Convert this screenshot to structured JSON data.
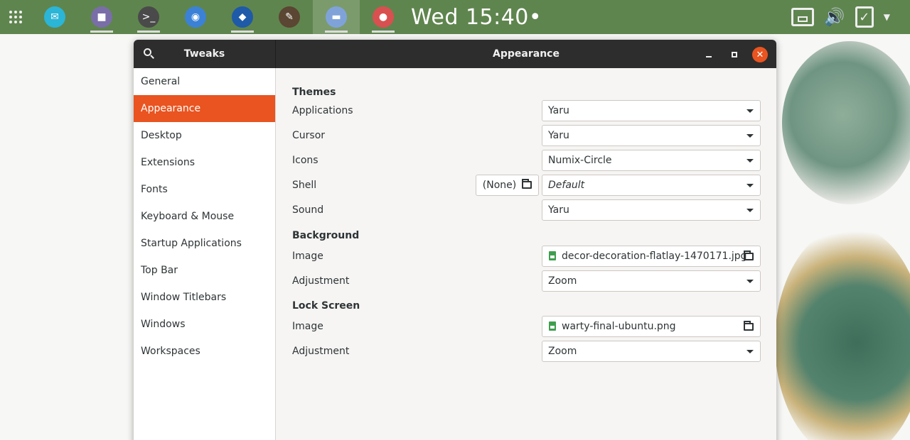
{
  "topbar": {
    "clock": "Wed 15:40",
    "clock_dot": "•",
    "apps": [
      {
        "name": "email-app",
        "icon": "envelope-icon",
        "color": "#2bb5d6",
        "running": false,
        "active": false,
        "glyph": "✉"
      },
      {
        "name": "files-app",
        "icon": "folder-icon",
        "color": "#7a6ea8",
        "running": true,
        "active": false,
        "glyph": "■"
      },
      {
        "name": "terminal-app",
        "icon": "terminal-icon",
        "color": "#4a4a4a",
        "running": true,
        "active": false,
        "glyph": ">_"
      },
      {
        "name": "chromium-app",
        "icon": "chromium-icon",
        "color": "#3b82d6",
        "running": false,
        "active": false,
        "glyph": "◉"
      },
      {
        "name": "vscode-app",
        "icon": "vscode-icon",
        "color": "#1e5aa8",
        "running": true,
        "active": false,
        "glyph": "◆"
      },
      {
        "name": "gimp-app",
        "icon": "gimp-icon",
        "color": "#5a4632",
        "running": false,
        "active": false,
        "glyph": "✎"
      },
      {
        "name": "tweaks-app",
        "icon": "tweaks-icon",
        "color": "#7fa3d9",
        "running": true,
        "active": true,
        "glyph": "▬"
      },
      {
        "name": "settings-app",
        "icon": "toggle-icon",
        "color": "#d95050",
        "running": true,
        "active": false,
        "glyph": "●"
      }
    ]
  },
  "window": {
    "sidebar_title": "Tweaks",
    "title": "Appearance",
    "close_glyph": "✕"
  },
  "sidebar": {
    "items": [
      {
        "label": "General",
        "selected": false
      },
      {
        "label": "Appearance",
        "selected": true
      },
      {
        "label": "Desktop",
        "selected": false
      },
      {
        "label": "Extensions",
        "selected": false
      },
      {
        "label": "Fonts",
        "selected": false
      },
      {
        "label": "Keyboard & Mouse",
        "selected": false
      },
      {
        "label": "Startup Applications",
        "selected": false
      },
      {
        "label": "Top Bar",
        "selected": false
      },
      {
        "label": "Window Titlebars",
        "selected": false
      },
      {
        "label": "Windows",
        "selected": false
      },
      {
        "label": "Workspaces",
        "selected": false
      }
    ]
  },
  "themes": {
    "title": "Themes",
    "applications": {
      "label": "Applications",
      "value": "Yaru"
    },
    "cursor": {
      "label": "Cursor",
      "value": "Yaru"
    },
    "icons": {
      "label": "Icons",
      "value": "Numix-Circle"
    },
    "shell": {
      "label": "Shell",
      "value": "Default",
      "none_button": "(None)"
    },
    "sound": {
      "label": "Sound",
      "value": "Yaru"
    }
  },
  "background": {
    "title": "Background",
    "image": {
      "label": "Image",
      "value": "decor-decoration-flatlay-1470171.jpg"
    },
    "adjustment": {
      "label": "Adjustment",
      "value": "Zoom"
    }
  },
  "lockscreen": {
    "title": "Lock Screen",
    "image": {
      "label": "Image",
      "value": "warty-final-ubuntu.png"
    },
    "adjustment": {
      "label": "Adjustment",
      "value": "Zoom"
    }
  }
}
